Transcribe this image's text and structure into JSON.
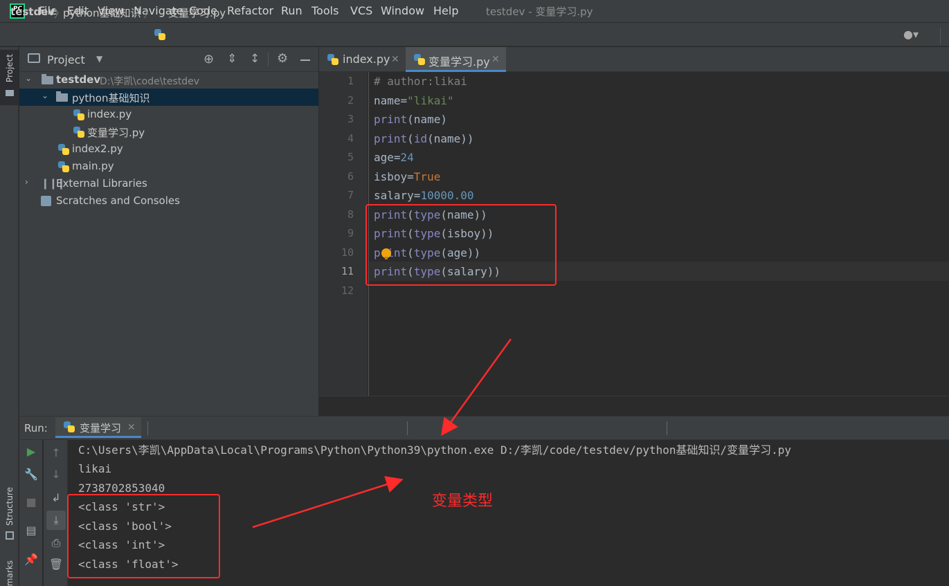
{
  "menu": {
    "logo": "PC",
    "items": [
      "File",
      "Edit",
      "View",
      "Navigate",
      "Code",
      "Refactor",
      "Run",
      "Tools",
      "VCS",
      "Window",
      "Help"
    ],
    "window_title": "testdev - 变量学习.py"
  },
  "breadcrumb": [
    "testdev",
    "python基础知识",
    "变量学习.py"
  ],
  "left_strip": {
    "project_label": "Project",
    "structure_label": "Structure",
    "bookmarks_label": "marks"
  },
  "project_panel": {
    "title": "Project",
    "tree": [
      {
        "label": "testdev",
        "path": "D:\\李凯\\code\\testdev"
      },
      {
        "label": "python基础知识"
      },
      {
        "label": "index.py"
      },
      {
        "label": "变量学习.py"
      },
      {
        "label": "index2.py"
      },
      {
        "label": "main.py"
      },
      {
        "label": "External Libraries"
      },
      {
        "label": "Scratches and Consoles"
      }
    ]
  },
  "editor": {
    "tabs": [
      {
        "label": "index.py",
        "active": false
      },
      {
        "label": "变量学习.py",
        "active": true
      }
    ],
    "line_numbers": [
      "1",
      "2",
      "3",
      "4",
      "5",
      "6",
      "7",
      "8",
      "9",
      "10",
      "11",
      "12"
    ],
    "current_line": "11",
    "code": [
      {
        "parts": [
          {
            "t": "# author:likai",
            "c": "comment"
          }
        ]
      },
      {
        "parts": [
          {
            "t": "name=",
            "c": ""
          },
          {
            "t": "\"likai\"",
            "c": "str"
          }
        ]
      },
      {
        "parts": [
          {
            "t": "print",
            "c": "builtin"
          },
          {
            "t": "(name)",
            "c": ""
          }
        ]
      },
      {
        "parts": [
          {
            "t": "print",
            "c": "builtin"
          },
          {
            "t": "(",
            "c": ""
          },
          {
            "t": "id",
            "c": "builtin"
          },
          {
            "t": "(name))",
            "c": ""
          }
        ]
      },
      {
        "parts": [
          {
            "t": "age=",
            "c": ""
          },
          {
            "t": "24",
            "c": "num"
          }
        ]
      },
      {
        "parts": [
          {
            "t": "isboy=",
            "c": ""
          },
          {
            "t": "True",
            "c": "kw"
          }
        ]
      },
      {
        "parts": [
          {
            "t": "salary=",
            "c": ""
          },
          {
            "t": "10000.00",
            "c": "num"
          }
        ]
      },
      {
        "parts": [
          {
            "t": "print",
            "c": "builtin"
          },
          {
            "t": "(",
            "c": ""
          },
          {
            "t": "type",
            "c": "builtin"
          },
          {
            "t": "(name))",
            "c": ""
          }
        ]
      },
      {
        "parts": [
          {
            "t": "print",
            "c": "builtin"
          },
          {
            "t": "(",
            "c": ""
          },
          {
            "t": "type",
            "c": "builtin"
          },
          {
            "t": "(isboy))",
            "c": ""
          }
        ]
      },
      {
        "parts": [
          {
            "t": "print",
            "c": "builtin"
          },
          {
            "t": "(",
            "c": ""
          },
          {
            "t": "type",
            "c": "builtin"
          },
          {
            "t": "(age))",
            "c": ""
          }
        ]
      },
      {
        "parts": [
          {
            "t": "print",
            "c": "builtin"
          },
          {
            "t": "(",
            "c": ""
          },
          {
            "t": "type",
            "c": "builtin"
          },
          {
            "t": "(salary))",
            "c": ""
          }
        ]
      },
      {
        "parts": []
      }
    ]
  },
  "run": {
    "label": "Run:",
    "tab_label": "变量学习",
    "output": [
      "C:\\Users\\李凯\\AppData\\Local\\Programs\\Python\\Python39\\python.exe D:/李凯/code/testdev/python基础知识/变量学习.py",
      "likai",
      "2738702853040",
      "<class 'str'>",
      "<class 'bool'>",
      "<class 'int'>",
      "<class 'float'>"
    ]
  },
  "annotation": {
    "label": "变量类型",
    "color": "#ff2a2a"
  },
  "colors": {
    "accent": "#4a88c7",
    "run_green": "#499c54",
    "selection": "#0d293e"
  }
}
